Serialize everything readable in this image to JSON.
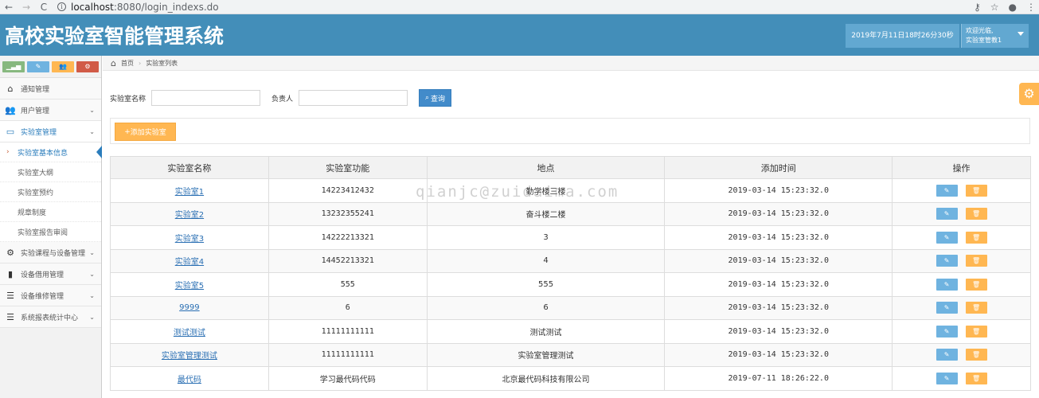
{
  "browser": {
    "url_host": "localhost",
    "url_path": ":8080/login_indexs.do",
    "back": "←",
    "forward": "→",
    "reload": "C",
    "info": "i",
    "key_icon": "⚷",
    "star_icon": "☆",
    "account_icon": "●",
    "menu_icon": "⋮"
  },
  "header": {
    "title": "高校实验室智能管理系统",
    "datetime": "2019年7月11日18时26分30秒",
    "welcome": "欢迎光临,",
    "user": "实验室管教1"
  },
  "sidebar": {
    "shortcuts": [
      {
        "icon": "chart-icon",
        "glyph": "▁▃▅"
      },
      {
        "icon": "pencil-icon",
        "glyph": "✎"
      },
      {
        "icon": "users-icon",
        "glyph": "👥"
      },
      {
        "icon": "cogs-icon",
        "glyph": "⚙"
      }
    ],
    "items": [
      {
        "label": "通知管理",
        "icon": "home-icon",
        "glyph": "⌂"
      },
      {
        "label": "用户管理",
        "icon": "users-icon",
        "glyph": "👥"
      },
      {
        "label": "实验室管理",
        "icon": "desktop-icon",
        "glyph": "▭"
      },
      {
        "label": "实验课程与设备管理",
        "icon": "cogs-icon",
        "glyph": "⚙"
      },
      {
        "label": "设备借用管理",
        "icon": "bookmark-icon",
        "glyph": "▮"
      },
      {
        "label": "设备维修管理",
        "icon": "list-icon",
        "glyph": "☰"
      },
      {
        "label": "系统报表统计中心",
        "icon": "list-icon",
        "glyph": "☰"
      }
    ],
    "submenu": [
      "实验室基本信息",
      "实验室大纲",
      "实验室预约",
      "规章制度",
      "实验室报告审阅"
    ]
  },
  "breadcrumb": {
    "home": "首页",
    "current": "实验室列表"
  },
  "search": {
    "name_label": "实验室名称",
    "owner_label": "负责人",
    "query_label": "查询"
  },
  "toolbar": {
    "add_label": "添加实验室"
  },
  "table": {
    "headers": [
      "实验室名称",
      "实验室功能",
      "地点",
      "添加时间",
      "操作"
    ],
    "rows": [
      {
        "name": "实验室1",
        "func": "14223412432",
        "place": "勤学楼三楼",
        "time": "2019-03-14 15:23:32.0"
      },
      {
        "name": "实验室2",
        "func": "13232355241",
        "place": "奋斗楼二楼",
        "time": "2019-03-14 15:23:32.0"
      },
      {
        "name": "实验室3",
        "func": "14222213321",
        "place": "3",
        "time": "2019-03-14 15:23:32.0"
      },
      {
        "name": "实验室4",
        "func": "14452213321",
        "place": "4",
        "time": "2019-03-14 15:23:32.0"
      },
      {
        "name": "实验室5",
        "func": "555",
        "place": "555",
        "time": "2019-03-14 15:23:32.0"
      },
      {
        "name": "9999",
        "func": "6",
        "place": "6",
        "time": "2019-03-14 15:23:32.0"
      },
      {
        "name": "测试测试",
        "func": "11111111111",
        "place": "测试测试",
        "time": "2019-03-14 15:23:32.0"
      },
      {
        "name": "实验室管理测试",
        "func": "11111111111",
        "place": "实验室管理测试",
        "time": "2019-03-14 15:23:32.0"
      },
      {
        "name": "最代码",
        "func": "学习最代码代码",
        "place": "北京最代码科技有限公司",
        "time": "2019-07-11 18:26:22.0"
      }
    ],
    "edit_glyph": "✎",
    "delete_glyph": "🗑"
  },
  "watermark": "qianjc@zuidaima.com",
  "colors": {
    "header": "#438eb9",
    "accent_blue": "#428bca",
    "accent_orange": "#ffb752",
    "link": "#2a6fb3"
  }
}
